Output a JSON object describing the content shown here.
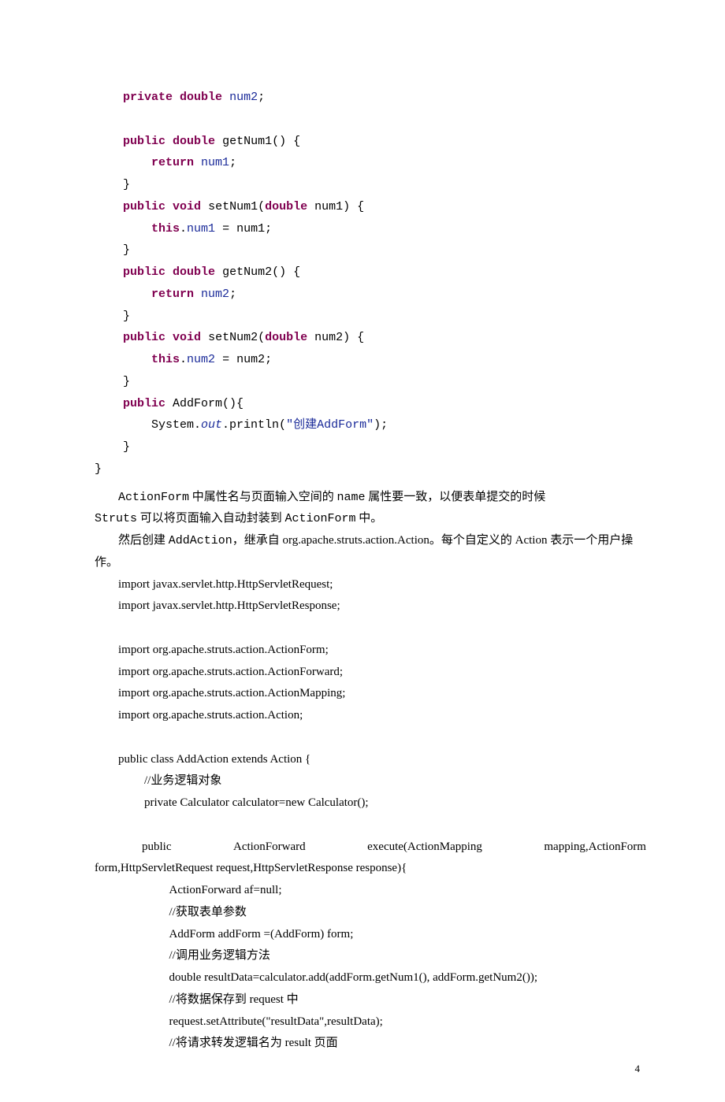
{
  "code": {
    "l1": "private",
    "l1b": "double",
    "l1c": "num2",
    "l1d": ";",
    "l2a": "public",
    "l2b": "double",
    "l2c": " getNum1() {",
    "l3a": "return",
    "l3b": "num1",
    "l3c": ";",
    "l4": "}",
    "l5a": "public",
    "l5b": "void",
    "l5c": " setNum1(",
    "l5d": "double",
    "l5e": " num1) {",
    "l6a": "this",
    "l6b": ".",
    "l6c": "num1",
    "l6d": " = num1;",
    "l7": "}",
    "l8a": "public",
    "l8b": "double",
    "l8c": " getNum2() {",
    "l9a": "return",
    "l9b": "num2",
    "l9c": ";",
    "l10": "}",
    "l11a": "public",
    "l11b": "void",
    "l11c": " setNum2(",
    "l11d": "double",
    "l11e": " num2) {",
    "l12a": "this",
    "l12b": ".",
    "l12c": "num2",
    "l12d": " = num2;",
    "l13": "}",
    "l14a": "public",
    "l14b": " AddForm(){",
    "l15a": "System.",
    "l15b": "out",
    "l15c": ".println(",
    "l15d": "\"创建AddForm\"",
    "l15e": ");",
    "l16": "}",
    "l17": "}"
  },
  "prose": {
    "p1a": "ActionForm",
    "p1b": " 中属性名与页面输入空间的 ",
    "p1c": "name",
    "p1d": " 属性要一致，以便表单提交的时候",
    "p1e": "Struts",
    "p1f": " 可以将页面输入自动封装到 ",
    "p1g": "ActionForm",
    "p1h": " 中。",
    "p2a": "然后创建 ",
    "p2b": "AddAction",
    "p2c": "，继承自 org.apache.struts.action.Action。每个自定义的 Action 表示一个用户操作。",
    "p3": "import javax.servlet.http.HttpServletRequest;",
    "p4": "import javax.servlet.http.HttpServletResponse;",
    "p5": "import org.apache.struts.action.ActionForm;",
    "p6": "import org.apache.struts.action.ActionForward;",
    "p7": "import org.apache.struts.action.ActionMapping;",
    "p8": "import org.apache.struts.action.Action;",
    "p9": "public class AddAction extends Action {",
    "p10": "//业务逻辑对象",
    "p11": "private Calculator calculator=new Calculator();",
    "p12a": "public",
    "p12b": "ActionForward",
    "p12c": "execute(ActionMapping",
    "p12d": "mapping,ActionForm",
    "p12e": "form,HttpServletRequest request,HttpServletResponse response){",
    "p13": "ActionForward af=null;",
    "p14": "//获取表单参数",
    "p15": "AddForm addForm =(AddForm) form;",
    "p16": "//调用业务逻辑方法",
    "p17": "double resultData=calculator.add(addForm.getNum1(), addForm.getNum2());",
    "p18": "//将数据保存到 request 中",
    "p19": "request.setAttribute(\"resultData\",resultData);",
    "p20": "//将请求转发逻辑名为 result  页面"
  },
  "page_number": "4"
}
